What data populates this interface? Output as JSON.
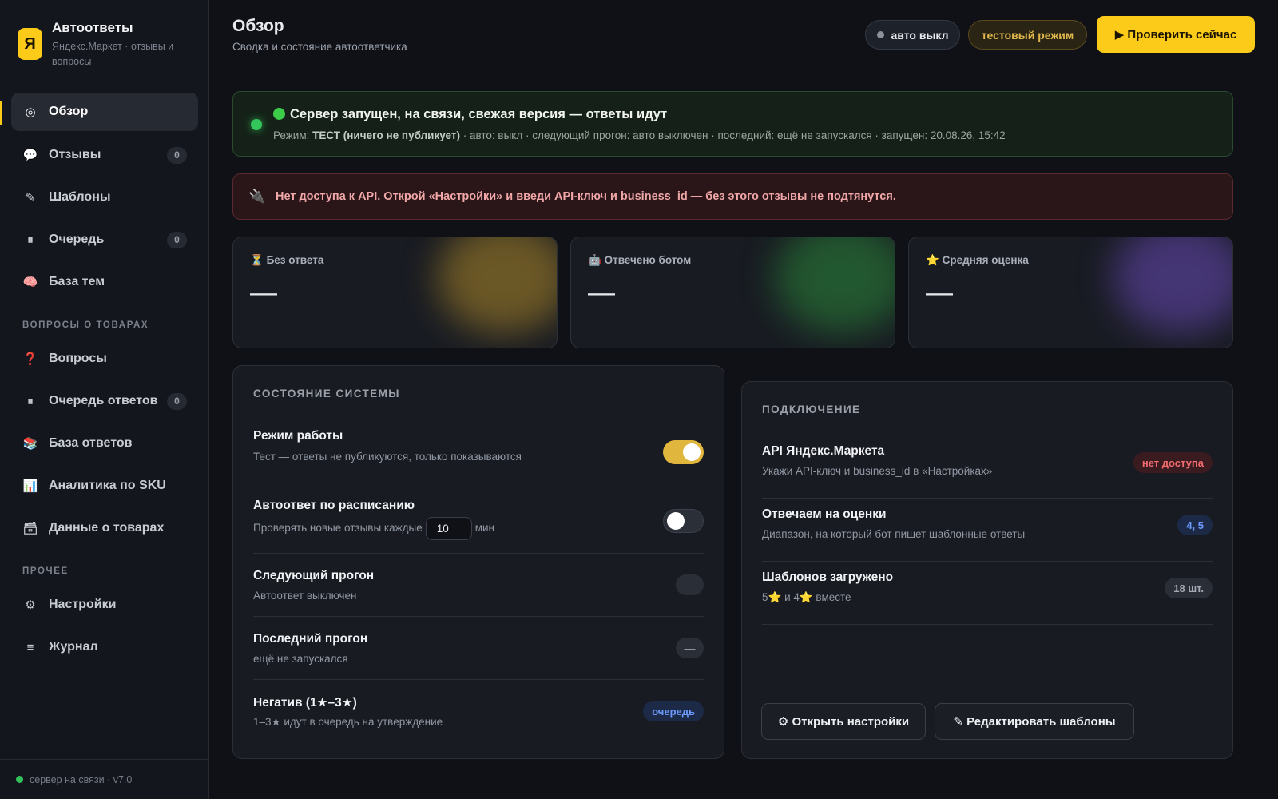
{
  "brand": {
    "logo_letter": "Я",
    "title": "Автоответы",
    "subtitle": "Яндекс.Маркет · отзывы и вопросы"
  },
  "sidebar": {
    "items": [
      {
        "icon": "◎",
        "icon_name": "overview-icon",
        "label": "Обзор",
        "active": true
      },
      {
        "icon": "💬",
        "icon_name": "reviews-icon",
        "label": "Отзывы",
        "badge": "0"
      },
      {
        "icon": "✎",
        "icon_name": "templates-icon",
        "label": "Шаблоны"
      },
      {
        "icon": "⏸",
        "icon_name": "queue-icon",
        "label": "Очередь",
        "badge": "0"
      },
      {
        "icon": "🧠",
        "icon_name": "brain-icon",
        "label": "База тем"
      }
    ],
    "section_questions": "ВОПРОСЫ О ТОВАРАХ",
    "question_items": [
      {
        "icon": "❓",
        "icon_name": "question-icon",
        "label": "Вопросы"
      },
      {
        "icon": "⏸",
        "icon_name": "answers-queue-icon",
        "label": "Очередь ответов",
        "badge": "0"
      },
      {
        "icon": "📚",
        "icon_name": "books-icon",
        "label": "База ответов"
      },
      {
        "icon": "📊",
        "icon_name": "chart-icon",
        "label": "Аналитика по SKU"
      },
      {
        "icon": "🗃",
        "icon_name": "box-icon",
        "label": "Данные о товарах"
      }
    ],
    "section_other": "ПРОЧЕЕ",
    "other_items": [
      {
        "icon": "⚙",
        "icon_name": "gear-icon",
        "label": "Настройки"
      },
      {
        "icon": "≡",
        "icon_name": "log-icon",
        "label": "Журнал"
      }
    ],
    "footer": "сервер на связи · v7.0"
  },
  "header": {
    "title": "Обзор",
    "subtitle": "Сводка и состояние автоответчика",
    "auto_pill": "авто выкл",
    "test_pill": "тестовый режим",
    "check_button": "▶ Проверить сейчас"
  },
  "status_banner": {
    "title": "Сервер запущен, на связи, свежая версия — ответы идут",
    "mode_label": "Режим: ",
    "mode_value": "ТЕСТ (ничего не публикует)",
    "meta": " · авто: выкл · следующий прогон: авто выключен · последний: ещё не запускался · запущен: 20.08.26, 15:42"
  },
  "error_banner": {
    "icon": "🔌",
    "text": "Нет доступа к API. Открой «Настройки» и введи API-ключ и business_id — без этого отзывы не подтянутся."
  },
  "stats": [
    {
      "icon": "⏳",
      "label": "Без ответа",
      "value": "—",
      "glow": "#b08a2a"
    },
    {
      "icon": "🤖",
      "label": "Отвечено ботом",
      "value": "—",
      "glow": "#2c8a3b"
    },
    {
      "icon": "⭐",
      "label": "Средняя оценка",
      "value": "—",
      "glow": "#6a4bb8"
    }
  ],
  "system": {
    "title": "СОСТОЯНИЕ СИСТЕМЫ",
    "mode": {
      "title": "Режим работы",
      "sub": "Тест — ответы не публикуются, только показываются",
      "on": true
    },
    "schedule": {
      "title": "Автоответ по расписанию",
      "sub_before": "Проверять новые отзывы каждые",
      "interval": "10",
      "sub_after": "мин",
      "on": false
    },
    "next_run": {
      "title": "Следующий прогон",
      "sub": "Автоответ выключен",
      "value": "—"
    },
    "last_run": {
      "title": "Последний прогон",
      "sub": "ещё не запускался",
      "value": "—"
    },
    "negative": {
      "title": "Негатив (1★–3★)",
      "sub": "1–3★ идут в очередь на утверждение",
      "tag": "очередь"
    }
  },
  "connection": {
    "title": "ПОДКЛЮЧЕНИЕ",
    "api": {
      "title": "API Яндекс.Маркета",
      "sub": "Укажи API-ключ и business_id в «Настройках»",
      "tag": "нет доступа"
    },
    "ratings": {
      "title": "Отвечаем на оценки",
      "sub": "Диапазон, на который бот пишет шаблонные ответы",
      "tag": "4, 5"
    },
    "templates": {
      "title": "Шаблонов загружено",
      "sub": "5⭐ и 4⭐ вместе",
      "tag": "18 шт."
    },
    "open_settings": "⚙ Открыть настройки",
    "edit_templates": "✎ Редактировать шаблоны"
  }
}
